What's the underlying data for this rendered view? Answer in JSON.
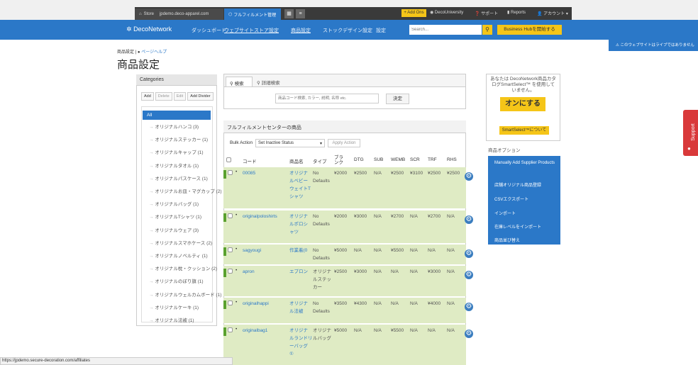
{
  "topbar": {
    "store_label": "Store",
    "store_url": "jpdemo.deco-apparel.com",
    "fulfillment_tab": "フルフィルメント管理",
    "add_ons": "+ Add Ons",
    "deco_university": "DecoUniversity",
    "support": "サポート",
    "reports": "Reports",
    "account": "アカウント"
  },
  "nav": {
    "brand": "DecoNetwork",
    "items": [
      "ダッシュボード",
      "ウェブサイトストア設定",
      "商品設定",
      "ストックデザイン設定",
      "設定"
    ],
    "search_placeholder": "Search...",
    "business_hub": "Business Hubを開始する"
  },
  "notice": "このウェブサイトはライブではありません",
  "breadcrumb": "商品設定",
  "page_help": "ページヘルプ",
  "page_title": "商品設定",
  "categories": {
    "header": "Categories",
    "buttons": [
      "Add",
      "Delete",
      "Edit",
      "Add Divider"
    ],
    "items": [
      "All",
      "オリジナルハンコ (3)",
      "オリジナルステッカー (1)",
      "オリジナルキャップ (1)",
      "オリジナルタオル (1)",
      "オリジナルパスケース (1)",
      "オリジナルお皿・マグカップ (2)",
      "オリジナルバッグ (1)",
      "オリジナルTシャツ (1)",
      "オリジナルウェア (3)",
      "オリジナルスマホケース (2)",
      "オリジナルノベルティ (1)",
      "オリジナル枕・クッション (2)",
      "オリジナルのぼり旗 (1)",
      "オリジナルウェルカムボード (1)",
      "オリジナルケーキ (1)",
      "オリジナル法被 (1)"
    ]
  },
  "search": {
    "tab_search": "検索",
    "tab_advanced": "詳細検索",
    "placeholder": "商品コード検索, カラー, 説明, 名称 etc.",
    "submit": "決定"
  },
  "smartselect": {
    "text": "あなたは DecoNetwork商品カタログSmartSelect™ を使用していません。",
    "turn_on": "オンにする",
    "about": "SmartSelect™について"
  },
  "product_options": {
    "title": "商品オプション",
    "items": [
      "Manually Add Supplier Products",
      "店舗オリジナル商品登録",
      "CSVエクスポート",
      "インポート",
      "在庫レベルをインポート",
      "商品並び替え"
    ]
  },
  "fulfillment": {
    "header": "フルフィルメントセンターの商品",
    "bulk_label": "Bulk Action",
    "bulk_value": "Set Inactive Status",
    "apply": "Apply Action",
    "columns": [
      "コード",
      "商品名",
      "タイプ",
      "ブランク",
      "DTG",
      "SUB",
      "WEMB",
      "SCR",
      "TRF",
      "RHS"
    ],
    "rows": [
      {
        "code": "00085",
        "name": [
          "オリジナ",
          "ルベビー",
          "ウェイトT",
          "シャツ"
        ],
        "type": [
          "No",
          "Defaults"
        ],
        "blank": "¥2000",
        "dtg": "¥2500",
        "sub": "N/A",
        "wemb": "¥2500",
        "scr": "¥3100",
        "trf": "¥2500",
        "rhs": "¥2500"
      },
      {
        "code": "originalpoloshirts",
        "name": [
          "オリジナ",
          "ルポロシ",
          "ャツ"
        ],
        "type": [
          "No",
          "Defaults"
        ],
        "blank": "¥2000",
        "dtg": "¥3000",
        "sub": "N/A",
        "wemb": "¥2700",
        "scr": "N/A",
        "trf": "¥2700",
        "rhs": "N/A"
      },
      {
        "code": "sagyougi",
        "name": [
          "作業着(0"
        ],
        "type": [
          "No",
          "Defaults"
        ],
        "blank": "¥5000",
        "dtg": "N/A",
        "sub": "N/A",
        "wemb": "¥5500",
        "scr": "N/A",
        "trf": "N/A",
        "rhs": "N/A"
      },
      {
        "code": "apron",
        "name": [
          "エプロン"
        ],
        "type": [
          "オリジナ",
          "ルステッ",
          "カー"
        ],
        "blank": "¥2500",
        "dtg": "¥3000",
        "sub": "N/A",
        "wemb": "N/A",
        "scr": "N/A",
        "trf": "¥3000",
        "rhs": "N/A"
      },
      {
        "code": "originalhappi",
        "name": [
          "オリジナ",
          "ル法被"
        ],
        "type": [
          "No",
          "Defaults"
        ],
        "blank": "¥3500",
        "dtg": "¥4300",
        "sub": "N/A",
        "wemb": "N/A",
        "scr": "N/A",
        "trf": "¥4000",
        "rhs": "N/A"
      },
      {
        "code": "originalbag1",
        "name": [
          "オリジナ",
          "ルランドリ",
          "ーバッグ",
          "①"
        ],
        "type": [
          "オリジナ",
          "ルバッグ"
        ],
        "blank": "¥5000",
        "dtg": "N/A",
        "sub": "N/A",
        "wemb": "¥5500",
        "scr": "N/A",
        "trf": "N/A",
        "rhs": "N/A"
      }
    ]
  },
  "support_tab": "Support",
  "status_url": "https://jpdemo.secure-decoration.com/affiliates",
  "colors": {
    "nav": "#2b78c8",
    "accent_yellow": "#f5c518",
    "row_green": "#dfebc4"
  }
}
